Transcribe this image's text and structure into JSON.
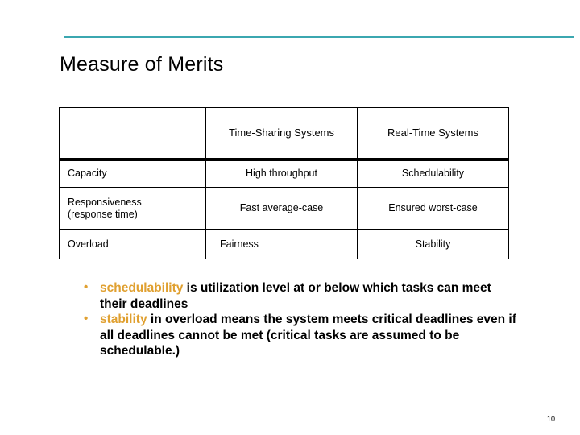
{
  "slide": {
    "title": "Measure of Merits",
    "page_number": "10",
    "accent_rule_color": "#3BA7B0",
    "keyword_color": "#E0A030"
  },
  "table": {
    "headers": [
      "",
      "Time-Sharing Systems",
      "Real-Time Systems"
    ],
    "rows": [
      {
        "criterion": "Capacity",
        "time_sharing": "High throughput",
        "real_time": "Schedulability"
      },
      {
        "criterion": "Responsiveness\n(response time)",
        "criterion_line1": "Responsiveness",
        "criterion_line2": "(response time)",
        "time_sharing": "Fast average-case",
        "real_time": "Ensured worst-case"
      },
      {
        "criterion": "Overload",
        "time_sharing": "Fairness",
        "real_time": "Stability"
      }
    ]
  },
  "bullets": [
    {
      "marker": "•",
      "keyword": "schedulability",
      "rest": " is utilization level at or below which tasks can meet their deadlines"
    },
    {
      "marker": "•",
      "keyword": "stability",
      "rest": " in overload means the system meets critical deadlines even if all deadlines cannot be met (critical tasks are assumed to be schedulable.)"
    }
  ]
}
